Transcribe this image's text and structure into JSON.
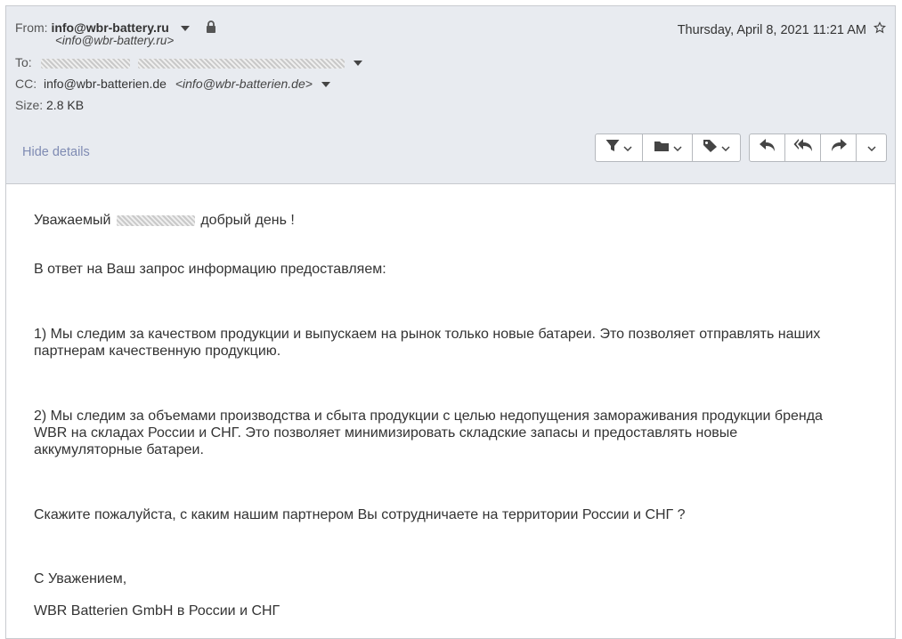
{
  "header": {
    "from_label": "From:",
    "from_name": "info@wbr-battery.ru",
    "from_addr": "<info@wbr-battery.ru>",
    "to_label": "To:",
    "cc_label": "CC:",
    "cc_name": "info@wbr-batterien.de",
    "cc_addr": "<info@wbr-batterien.de>",
    "size_label": "Size:",
    "size_value": "2.8 KB",
    "date": "Thursday, April 8, 2021 11:21 AM",
    "hide_details": "Hide details"
  },
  "toolbar": {
    "icons": [
      "filter-icon",
      "folder-icon",
      "tag-icon",
      "reply-icon",
      "reply-all-icon",
      "forward-icon",
      "more-icon"
    ]
  },
  "body": {
    "greeting_prefix": "Уважаемый",
    "greeting_suffix": "добрый день !",
    "p1": "В ответ на Ваш запрос информацию предоставляем:",
    "p2_line1": "1) Мы следим за качеством продукции и выпускаем на рынок только новые батареи. Это позволяет отправлять наших",
    "p2_line2": "партнерам качественную продукцию.",
    "p3_line1": "2) Мы следим за объемами производства и сбыта продукции с целью недопущения замораживания продукции бренда",
    "p3_line2": "WBR на складах России и СНГ. Это позволяет минимизировать складские запасы и предоставлять новые",
    "p3_line3": "аккумуляторные батареи.",
    "p4": "Скажите пожалуйста, с каким нашим партнером Вы сотрудничаете на территории России и СНГ ?",
    "closing": "С Уважением,",
    "signature": "WBR Batterien GmbH в России и СНГ"
  },
  "colors": {
    "header_bg": "#e8ebf0",
    "link": "#7f8bb3",
    "text": "#333333"
  }
}
